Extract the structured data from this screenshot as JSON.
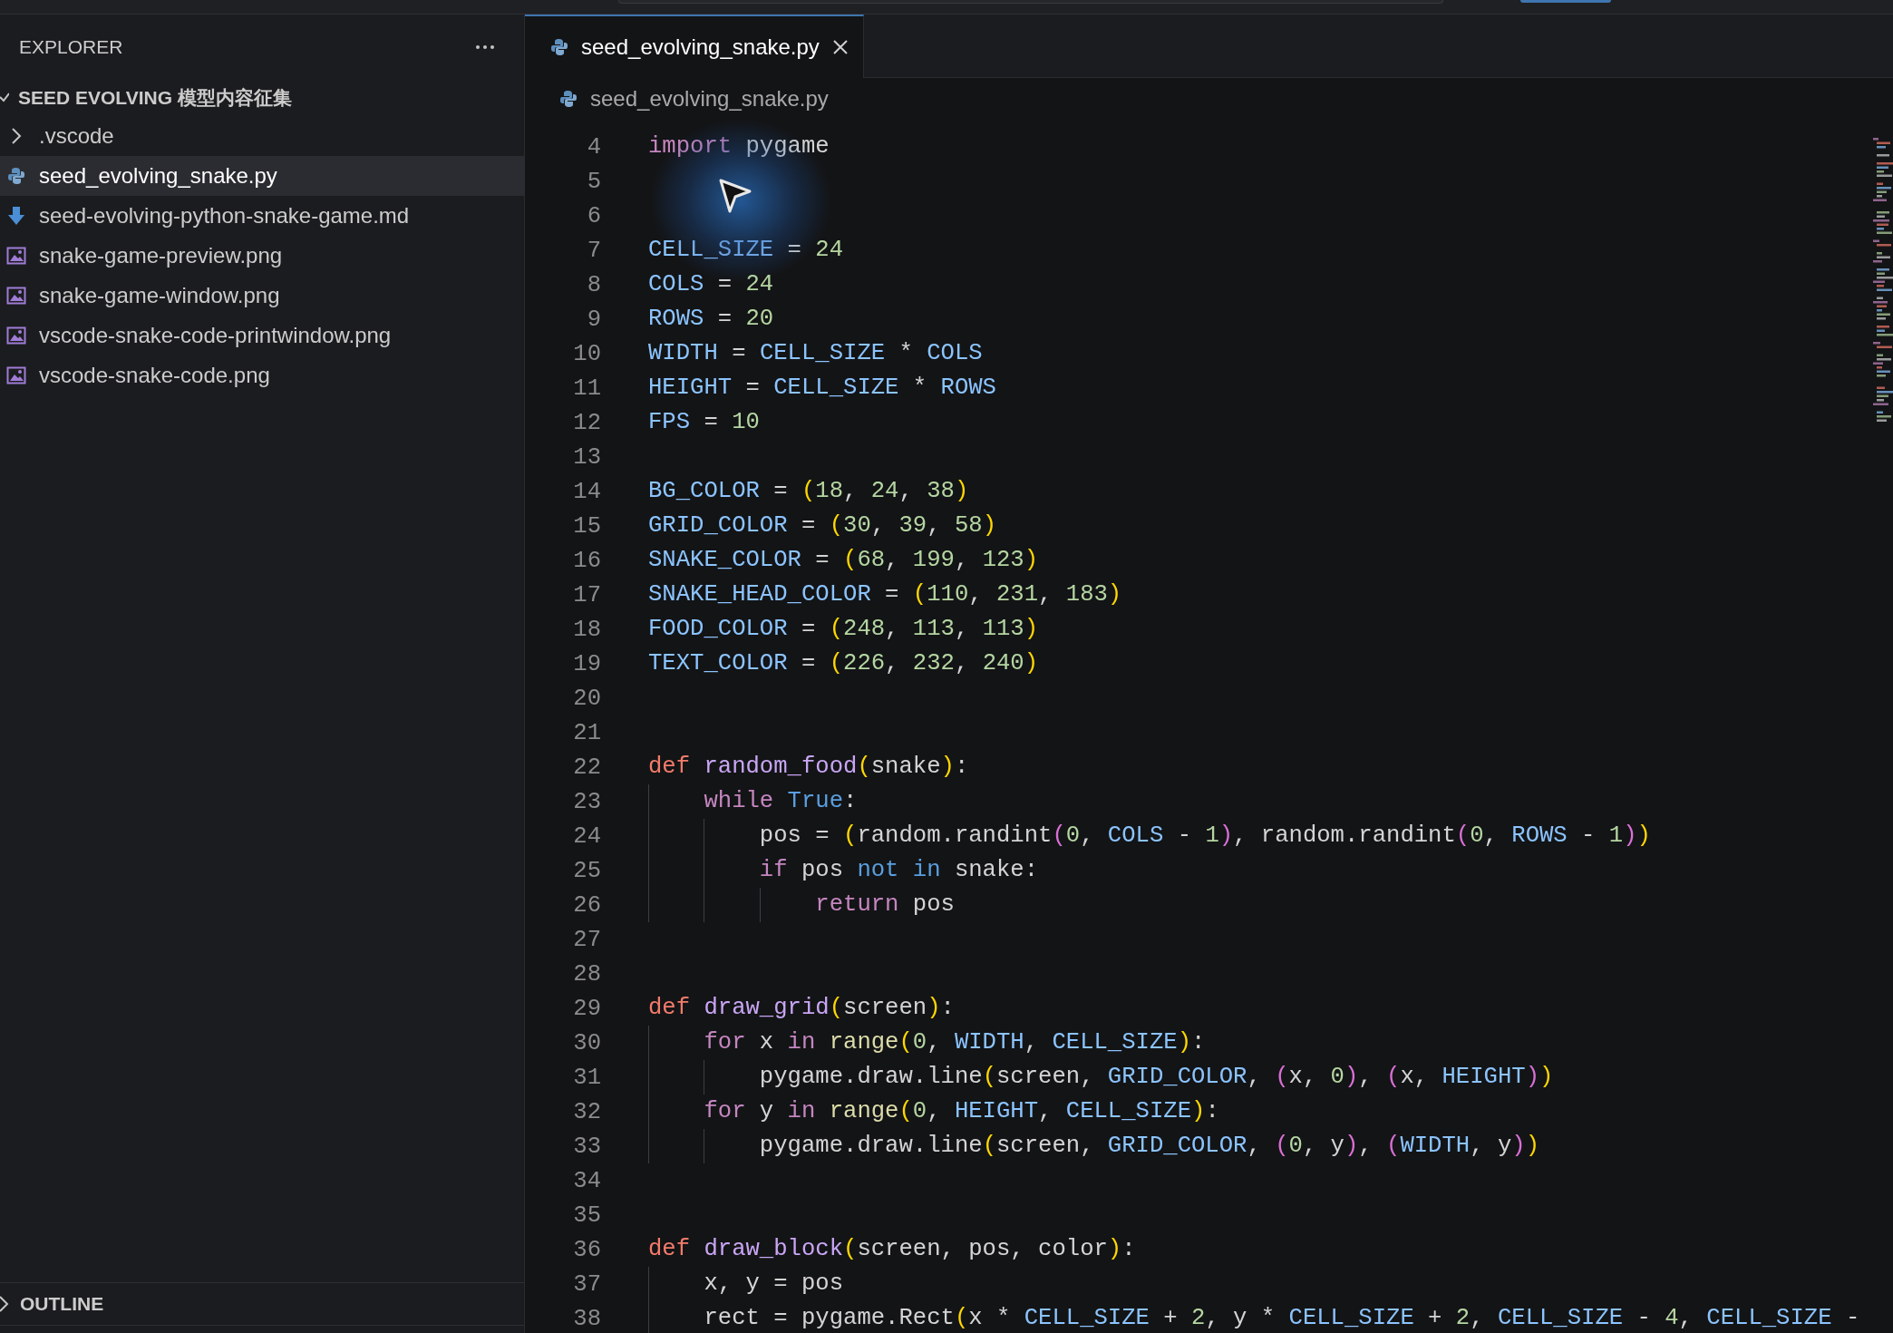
{
  "sidebar": {
    "title": "EXPLORER",
    "folder": {
      "name": "SEED EVOLVING 模型内容征集",
      "expanded": true
    },
    "items": [
      {
        "name": ".vscode",
        "kind": "folder",
        "expanded": false,
        "selected": false
      },
      {
        "name": "seed_evolving_snake.py",
        "kind": "python",
        "selected": true
      },
      {
        "name": "seed-evolving-python-snake-game.md",
        "kind": "markdown",
        "selected": false
      },
      {
        "name": "snake-game-preview.png",
        "kind": "image",
        "selected": false
      },
      {
        "name": "snake-game-window.png",
        "kind": "image",
        "selected": false
      },
      {
        "name": "vscode-snake-code-printwindow.png",
        "kind": "image",
        "selected": false
      },
      {
        "name": "vscode-snake-code.png",
        "kind": "image",
        "selected": false
      }
    ],
    "outline": {
      "title": "OUTLINE",
      "expanded": false
    }
  },
  "tabs": [
    {
      "label": "seed_evolving_snake.py",
      "selected": true
    }
  ],
  "breadcrumb": [
    "seed_evolving_snake.py"
  ],
  "editor": {
    "lines": [
      {
        "number": "4",
        "tokens": [
          {
            "text": "import",
            "kind": "keyword"
          },
          {
            "text": " pygame",
            "kind": "plain"
          }
        ]
      },
      {
        "number": "5"
      },
      {
        "number": "6"
      },
      {
        "number": "7",
        "tokens": [
          {
            "text": "CELL_SIZE",
            "kind": "const"
          },
          {
            "text": " = ",
            "kind": "plain"
          },
          {
            "text": "24",
            "kind": "num"
          }
        ]
      },
      {
        "number": "8",
        "tokens": [
          {
            "text": "COLS",
            "kind": "const"
          },
          {
            "text": " = ",
            "kind": "plain"
          },
          {
            "text": "24",
            "kind": "num"
          }
        ]
      },
      {
        "number": "9",
        "tokens": [
          {
            "text": "ROWS",
            "kind": "const"
          },
          {
            "text": " = ",
            "kind": "plain"
          },
          {
            "text": "20",
            "kind": "num"
          }
        ]
      },
      {
        "number": "10",
        "tokens": [
          {
            "text": "WIDTH",
            "kind": "const"
          },
          {
            "text": " = ",
            "kind": "plain"
          },
          {
            "text": "CELL_SIZE",
            "kind": "const"
          },
          {
            "text": " * ",
            "kind": "plain"
          },
          {
            "text": "COLS",
            "kind": "const"
          }
        ]
      },
      {
        "number": "11",
        "tokens": [
          {
            "text": "HEIGHT",
            "kind": "const"
          },
          {
            "text": " = ",
            "kind": "plain"
          },
          {
            "text": "CELL_SIZE",
            "kind": "const"
          },
          {
            "text": " * ",
            "kind": "plain"
          },
          {
            "text": "ROWS",
            "kind": "const"
          }
        ]
      },
      {
        "number": "12",
        "tokens": [
          {
            "text": "FPS",
            "kind": "const"
          },
          {
            "text": " = ",
            "kind": "plain"
          },
          {
            "text": "10",
            "kind": "num"
          }
        ]
      },
      {
        "number": "13"
      },
      {
        "number": "14",
        "tokens": [
          {
            "text": "BG_COLOR",
            "kind": "const"
          },
          {
            "text": " = ",
            "kind": "plain"
          },
          {
            "text": "(",
            "kind": "bracket1"
          },
          {
            "text": "18",
            "kind": "num"
          },
          {
            "text": ", ",
            "kind": "plain"
          },
          {
            "text": "24",
            "kind": "num"
          },
          {
            "text": ", ",
            "kind": "plain"
          },
          {
            "text": "38",
            "kind": "num"
          },
          {
            "text": ")",
            "kind": "bracket1"
          }
        ]
      },
      {
        "number": "15",
        "tokens": [
          {
            "text": "GRID_COLOR",
            "kind": "const"
          },
          {
            "text": " = ",
            "kind": "plain"
          },
          {
            "text": "(",
            "kind": "bracket1"
          },
          {
            "text": "30",
            "kind": "num"
          },
          {
            "text": ", ",
            "kind": "plain"
          },
          {
            "text": "39",
            "kind": "num"
          },
          {
            "text": ", ",
            "kind": "plain"
          },
          {
            "text": "58",
            "kind": "num"
          },
          {
            "text": ")",
            "kind": "bracket1"
          }
        ]
      },
      {
        "number": "16",
        "tokens": [
          {
            "text": "SNAKE_COLOR",
            "kind": "const"
          },
          {
            "text": " = ",
            "kind": "plain"
          },
          {
            "text": "(",
            "kind": "bracket1"
          },
          {
            "text": "68",
            "kind": "num"
          },
          {
            "text": ", ",
            "kind": "plain"
          },
          {
            "text": "199",
            "kind": "num"
          },
          {
            "text": ", ",
            "kind": "plain"
          },
          {
            "text": "123",
            "kind": "num"
          },
          {
            "text": ")",
            "kind": "bracket1"
          }
        ]
      },
      {
        "number": "17",
        "tokens": [
          {
            "text": "SNAKE_HEAD_COLOR",
            "kind": "const"
          },
          {
            "text": " = ",
            "kind": "plain"
          },
          {
            "text": "(",
            "kind": "bracket1"
          },
          {
            "text": "110",
            "kind": "num"
          },
          {
            "text": ", ",
            "kind": "plain"
          },
          {
            "text": "231",
            "kind": "num"
          },
          {
            "text": ", ",
            "kind": "plain"
          },
          {
            "text": "183",
            "kind": "num"
          },
          {
            "text": ")",
            "kind": "bracket1"
          }
        ]
      },
      {
        "number": "18",
        "tokens": [
          {
            "text": "FOOD_COLOR",
            "kind": "const"
          },
          {
            "text": " = ",
            "kind": "plain"
          },
          {
            "text": "(",
            "kind": "bracket1"
          },
          {
            "text": "248",
            "kind": "num"
          },
          {
            "text": ", ",
            "kind": "plain"
          },
          {
            "text": "113",
            "kind": "num"
          },
          {
            "text": ", ",
            "kind": "plain"
          },
          {
            "text": "113",
            "kind": "num"
          },
          {
            "text": ")",
            "kind": "bracket1"
          }
        ]
      },
      {
        "number": "19",
        "tokens": [
          {
            "text": "TEXT_COLOR",
            "kind": "const"
          },
          {
            "text": " = ",
            "kind": "plain"
          },
          {
            "text": "(",
            "kind": "bracket1"
          },
          {
            "text": "226",
            "kind": "num"
          },
          {
            "text": ", ",
            "kind": "plain"
          },
          {
            "text": "232",
            "kind": "num"
          },
          {
            "text": ", ",
            "kind": "plain"
          },
          {
            "text": "240",
            "kind": "num"
          },
          {
            "text": ")",
            "kind": "bracket1"
          }
        ]
      },
      {
        "number": "20"
      },
      {
        "number": "21"
      },
      {
        "number": "22",
        "tokens": [
          {
            "text": "def ",
            "kind": "def"
          },
          {
            "text": "random_food",
            "kind": "function"
          },
          {
            "text": "(",
            "kind": "bracket1"
          },
          {
            "text": "snake",
            "kind": "plain"
          },
          {
            "text": ")",
            "kind": "bracket1"
          },
          {
            "text": ":",
            "kind": "plain"
          }
        ]
      },
      {
        "number": "23",
        "tokens": [
          {
            "text": "    while ",
            "kind": "keyword"
          },
          {
            "text": "True",
            "kind": "literal"
          },
          {
            "text": ":",
            "kind": "plain"
          }
        ]
      },
      {
        "number": "24",
        "tokens": [
          {
            "text": "        pos = ",
            "kind": "plain"
          },
          {
            "text": "(",
            "kind": "bracket1"
          },
          {
            "text": "random.randint",
            "kind": "plain"
          },
          {
            "text": "(",
            "kind": "bracket2"
          },
          {
            "text": "0",
            "kind": "num"
          },
          {
            "text": ", ",
            "kind": "plain"
          },
          {
            "text": "COLS",
            "kind": "const"
          },
          {
            "text": " - ",
            "kind": "plain"
          },
          {
            "text": "1",
            "kind": "num"
          },
          {
            "text": ")",
            "kind": "bracket2"
          },
          {
            "text": ", random.randint",
            "kind": "plain"
          },
          {
            "text": "(",
            "kind": "bracket2"
          },
          {
            "text": "0",
            "kind": "num"
          },
          {
            "text": ", ",
            "kind": "plain"
          },
          {
            "text": "ROWS",
            "kind": "const"
          },
          {
            "text": " - ",
            "kind": "plain"
          },
          {
            "text": "1",
            "kind": "num"
          },
          {
            "text": ")",
            "kind": "bracket2"
          },
          {
            "text": ")",
            "kind": "bracket1"
          }
        ]
      },
      {
        "number": "25",
        "tokens": [
          {
            "text": "        if",
            "kind": "keyword"
          },
          {
            "text": " pos ",
            "kind": "plain"
          },
          {
            "text": "not in",
            "kind": "literal"
          },
          {
            "text": " snake:",
            "kind": "plain"
          }
        ]
      },
      {
        "number": "26",
        "tokens": [
          {
            "text": "            return",
            "kind": "keyword"
          },
          {
            "text": " pos",
            "kind": "plain"
          }
        ]
      },
      {
        "number": "27"
      },
      {
        "number": "28"
      },
      {
        "number": "29",
        "tokens": [
          {
            "text": "def ",
            "kind": "def"
          },
          {
            "text": "draw_grid",
            "kind": "function"
          },
          {
            "text": "(",
            "kind": "bracket1"
          },
          {
            "text": "screen",
            "kind": "plain"
          },
          {
            "text": ")",
            "kind": "bracket1"
          },
          {
            "text": ":",
            "kind": "plain"
          }
        ]
      },
      {
        "number": "30",
        "tokens": [
          {
            "text": "    for",
            "kind": "keyword"
          },
          {
            "text": " x ",
            "kind": "plain"
          },
          {
            "text": "in ",
            "kind": "keyword"
          },
          {
            "text": "range",
            "kind": "builtin"
          },
          {
            "text": "(",
            "kind": "bracket1"
          },
          {
            "text": "0",
            "kind": "num"
          },
          {
            "text": ", ",
            "kind": "plain"
          },
          {
            "text": "WIDTH",
            "kind": "const"
          },
          {
            "text": ", ",
            "kind": "plain"
          },
          {
            "text": "CELL_SIZE",
            "kind": "const"
          },
          {
            "text": ")",
            "kind": "bracket1"
          },
          {
            "text": ":",
            "kind": "plain"
          }
        ]
      },
      {
        "number": "31",
        "tokens": [
          {
            "text": "        pygame.draw.line",
            "kind": "plain"
          },
          {
            "text": "(",
            "kind": "bracket1"
          },
          {
            "text": "screen, ",
            "kind": "plain"
          },
          {
            "text": "GRID_COLOR",
            "kind": "const"
          },
          {
            "text": ", ",
            "kind": "plain"
          },
          {
            "text": "(",
            "kind": "bracket2"
          },
          {
            "text": "x, ",
            "kind": "plain"
          },
          {
            "text": "0",
            "kind": "num"
          },
          {
            "text": ")",
            "kind": "bracket2"
          },
          {
            "text": ", ",
            "kind": "plain"
          },
          {
            "text": "(",
            "kind": "bracket2"
          },
          {
            "text": "x, ",
            "kind": "plain"
          },
          {
            "text": "HEIGHT",
            "kind": "const"
          },
          {
            "text": ")",
            "kind": "bracket2"
          },
          {
            "text": ")",
            "kind": "bracket1"
          }
        ]
      },
      {
        "number": "32",
        "tokens": [
          {
            "text": "    for",
            "kind": "keyword"
          },
          {
            "text": " y ",
            "kind": "plain"
          },
          {
            "text": "in ",
            "kind": "keyword"
          },
          {
            "text": "range",
            "kind": "builtin"
          },
          {
            "text": "(",
            "kind": "bracket1"
          },
          {
            "text": "0",
            "kind": "num"
          },
          {
            "text": ", ",
            "kind": "plain"
          },
          {
            "text": "HEIGHT",
            "kind": "const"
          },
          {
            "text": ", ",
            "kind": "plain"
          },
          {
            "text": "CELL_SIZE",
            "kind": "const"
          },
          {
            "text": ")",
            "kind": "bracket1"
          },
          {
            "text": ":",
            "kind": "plain"
          }
        ]
      },
      {
        "number": "33",
        "tokens": [
          {
            "text": "        pygame.draw.line",
            "kind": "plain"
          },
          {
            "text": "(",
            "kind": "bracket1"
          },
          {
            "text": "screen, ",
            "kind": "plain"
          },
          {
            "text": "GRID_COLOR",
            "kind": "const"
          },
          {
            "text": ", ",
            "kind": "plain"
          },
          {
            "text": "(",
            "kind": "bracket2"
          },
          {
            "text": "0",
            "kind": "num"
          },
          {
            "text": ", y",
            "kind": "plain"
          },
          {
            "text": ")",
            "kind": "bracket2"
          },
          {
            "text": ", ",
            "kind": "plain"
          },
          {
            "text": "(",
            "kind": "bracket2"
          },
          {
            "text": "WIDTH",
            "kind": "const"
          },
          {
            "text": ", y",
            "kind": "plain"
          },
          {
            "text": ")",
            "kind": "bracket2"
          },
          {
            "text": ")",
            "kind": "bracket1"
          }
        ]
      },
      {
        "number": "34"
      },
      {
        "number": "35"
      },
      {
        "number": "36",
        "tokens": [
          {
            "text": "def ",
            "kind": "def"
          },
          {
            "text": "draw_block",
            "kind": "function"
          },
          {
            "text": "(",
            "kind": "bracket1"
          },
          {
            "text": "screen, pos, color",
            "kind": "plain"
          },
          {
            "text": ")",
            "kind": "bracket1"
          },
          {
            "text": ":",
            "kind": "plain"
          }
        ]
      },
      {
        "number": "37",
        "tokens": [
          {
            "text": "    x, y = pos",
            "kind": "plain"
          }
        ]
      },
      {
        "number": "38",
        "tokens": [
          {
            "text": "    rect = pygame.Rect",
            "kind": "plain"
          },
          {
            "text": "(",
            "kind": "bracket1"
          },
          {
            "text": "x * ",
            "kind": "plain"
          },
          {
            "text": "CELL_SIZE",
            "kind": "const"
          },
          {
            "text": " + ",
            "kind": "plain"
          },
          {
            "text": "2",
            "kind": "num"
          },
          {
            "text": ", y * ",
            "kind": "plain"
          },
          {
            "text": "CELL_SIZE",
            "kind": "const"
          },
          {
            "text": " + ",
            "kind": "plain"
          },
          {
            "text": "2",
            "kind": "num"
          },
          {
            "text": ", ",
            "kind": "plain"
          },
          {
            "text": "CELL_SIZE",
            "kind": "const"
          },
          {
            "text": " - ",
            "kind": "plain"
          },
          {
            "text": "4",
            "kind": "num"
          },
          {
            "text": ", ",
            "kind": "plain"
          },
          {
            "text": "CELL_SIZE",
            "kind": "const"
          },
          {
            "text": " -",
            "kind": "plain"
          }
        ]
      }
    ]
  }
}
